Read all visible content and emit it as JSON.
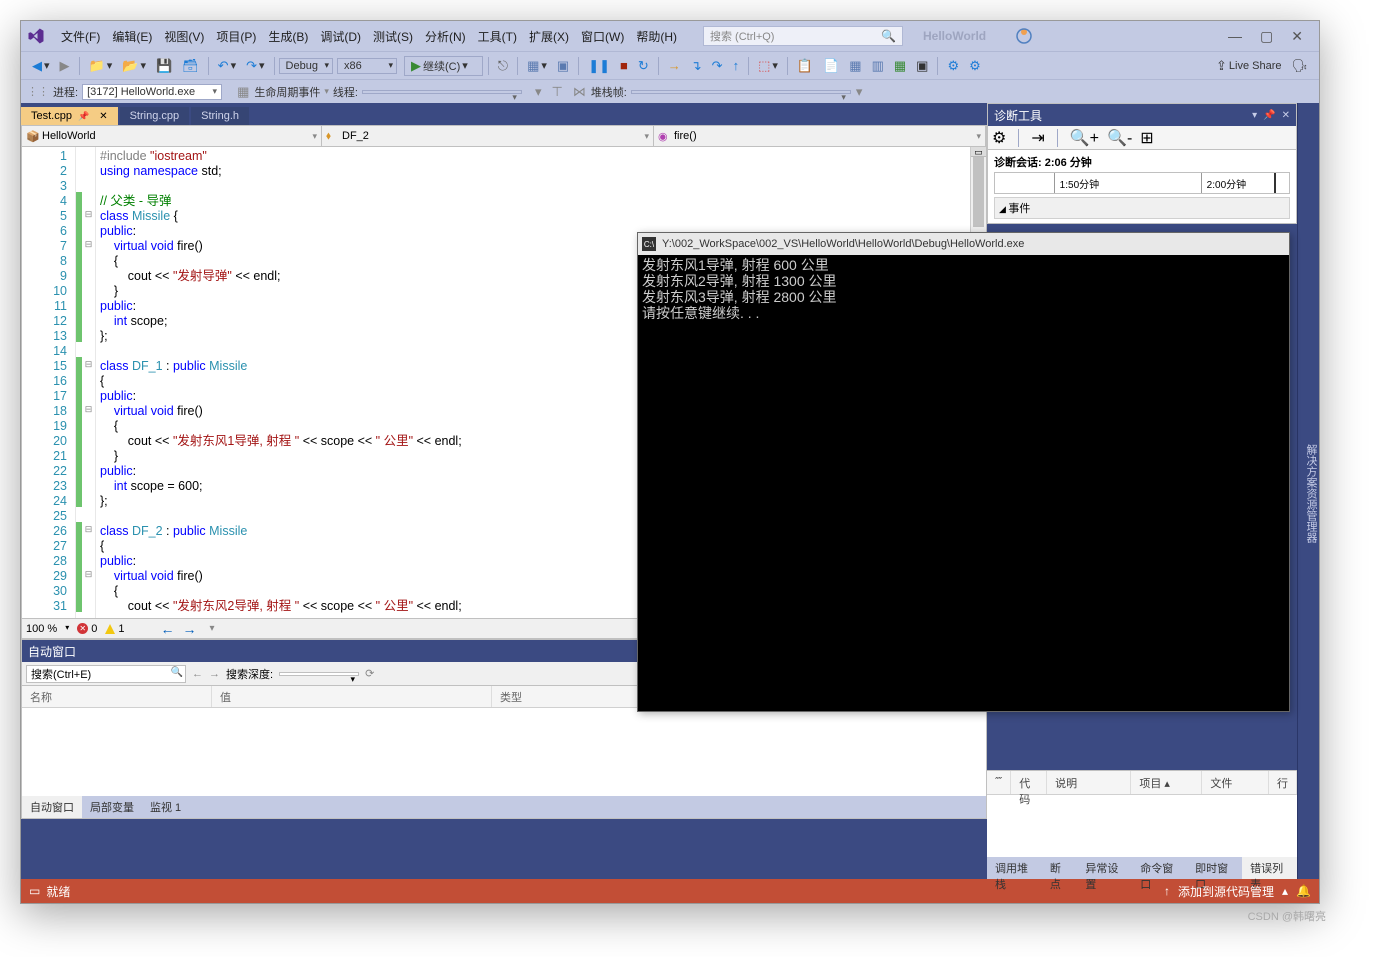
{
  "menu": {
    "file": "文件(F)",
    "edit": "编辑(E)",
    "view": "视图(V)",
    "project": "项目(P)",
    "build": "生成(B)",
    "debug": "调试(D)",
    "test": "测试(S)",
    "analyze": "分析(N)",
    "tools": "工具(T)",
    "extensions": "扩展(X)",
    "window": "窗口(W)",
    "help": "帮助(H)"
  },
  "search": {
    "placeholder": "搜索 (Ctrl+Q)"
  },
  "app_title": "HelloWorld",
  "toolbar": {
    "config": "Debug",
    "platform": "x86",
    "continue": "继续(C)",
    "live_share": "Live Share"
  },
  "toolbar2": {
    "process_label": "进程:",
    "process_value": "[3172] HelloWorld.exe",
    "lifecycle": "生命周期事件",
    "thread": "线程:",
    "stack": "堆栈帧:"
  },
  "tabs": {
    "t1": "Test.cpp",
    "t2": "String.cpp",
    "t3": "String.h"
  },
  "code_header": {
    "scope": "HelloWorld",
    "class": "DF_2",
    "func": "fire()"
  },
  "code": {
    "lines": [
      {
        "n": "1",
        "fold": "",
        "mark": "",
        "html": "<span class='pp'>#include </span><span class='str'>\"iostream\"</span>"
      },
      {
        "n": "2",
        "fold": "",
        "mark": "",
        "html": "<span class='kw'>using</span> <span class='kw'>namespace</span> std;"
      },
      {
        "n": "3",
        "fold": "",
        "mark": "",
        "html": ""
      },
      {
        "n": "4",
        "fold": "",
        "mark": "g",
        "html": "<span class='cmt'>// 父类 - 导弹</span>"
      },
      {
        "n": "5",
        "fold": "⊟",
        "mark": "g",
        "html": "<span class='kw'>class</span> <span class='typ'>Missile</span> {"
      },
      {
        "n": "6",
        "fold": "",
        "mark": "g",
        "html": "<span class='kw'>public</span>:"
      },
      {
        "n": "7",
        "fold": "⊟",
        "mark": "g",
        "html": "    <span class='kw'>virtual</span> <span class='kw'>void</span> fire()"
      },
      {
        "n": "8",
        "fold": "",
        "mark": "g",
        "html": "    {"
      },
      {
        "n": "9",
        "fold": "",
        "mark": "g",
        "html": "        cout &lt;&lt; <span class='str'>\"发射导弹\"</span> &lt;&lt; endl;"
      },
      {
        "n": "10",
        "fold": "",
        "mark": "g",
        "html": "    }"
      },
      {
        "n": "11",
        "fold": "",
        "mark": "g",
        "html": "<span class='kw'>public</span>:"
      },
      {
        "n": "12",
        "fold": "",
        "mark": "g",
        "html": "    <span class='kw'>int</span> scope;"
      },
      {
        "n": "13",
        "fold": "",
        "mark": "g",
        "html": "};"
      },
      {
        "n": "14",
        "fold": "",
        "mark": "",
        "html": ""
      },
      {
        "n": "15",
        "fold": "⊟",
        "mark": "g",
        "html": "<span class='kw'>class</span> <span class='typ'>DF_1</span> : <span class='kw'>public</span> <span class='typ'>Missile</span>"
      },
      {
        "n": "16",
        "fold": "",
        "mark": "g",
        "html": "{"
      },
      {
        "n": "17",
        "fold": "",
        "mark": "g",
        "html": "<span class='kw'>public</span>:"
      },
      {
        "n": "18",
        "fold": "⊟",
        "mark": "g",
        "html": "    <span class='kw'>virtual</span> <span class='kw'>void</span> fire()"
      },
      {
        "n": "19",
        "fold": "",
        "mark": "g",
        "html": "    {"
      },
      {
        "n": "20",
        "fold": "",
        "mark": "g",
        "html": "        cout &lt;&lt; <span class='str'>\"发射东风1导弹, 射程 \"</span> &lt;&lt; scope &lt;&lt; <span class='str'>\" 公里\"</span> &lt;&lt; endl;"
      },
      {
        "n": "21",
        "fold": "",
        "mark": "g",
        "html": "    }"
      },
      {
        "n": "22",
        "fold": "",
        "mark": "g",
        "html": "<span class='kw'>public</span>:"
      },
      {
        "n": "23",
        "fold": "",
        "mark": "g",
        "html": "    <span class='kw'>int</span> scope = 600;"
      },
      {
        "n": "24",
        "fold": "",
        "mark": "g",
        "html": "};"
      },
      {
        "n": "25",
        "fold": "",
        "mark": "",
        "html": ""
      },
      {
        "n": "26",
        "fold": "⊟",
        "mark": "g",
        "html": "<span class='kw'>class</span> <span class='typ'>DF_2</span> : <span class='kw'>public</span> <span class='typ'>Missile</span>"
      },
      {
        "n": "27",
        "fold": "",
        "mark": "g",
        "html": "{"
      },
      {
        "n": "28",
        "fold": "",
        "mark": "g",
        "html": "<span class='kw'>public</span>:"
      },
      {
        "n": "29",
        "fold": "⊟",
        "mark": "g",
        "html": "    <span class='kw'>virtual</span> <span class='kw'>void</span> fire()"
      },
      {
        "n": "30",
        "fold": "",
        "mark": "g",
        "html": "    {"
      },
      {
        "n": "31",
        "fold": "",
        "mark": "g",
        "html": "        cout &lt;&lt; <span class='str'>\"发射东风2导弹, 射程 \"</span> &lt;&lt; scope &lt;&lt; <span class='str'>\" 公里\"</span> &lt;&lt; endl;"
      }
    ],
    "zoom": "100 %",
    "errors": "0",
    "warnings": "1"
  },
  "autos": {
    "title": "自动窗口",
    "search_ph": "搜索(Ctrl+E)",
    "depth_label": "搜索深度:",
    "col_name": "名称",
    "col_value": "值",
    "col_type": "类型",
    "tab1": "自动窗口",
    "tab2": "局部变量",
    "tab3": "监视 1"
  },
  "diag": {
    "title": "诊断工具",
    "session": "诊断会话: 2:06 分钟",
    "tick1": "1:50分钟",
    "tick2": "2:00分钟",
    "events": "事件"
  },
  "error_list": {
    "col_code": "代码",
    "col_desc": "说明",
    "col_proj": "项目",
    "col_file": "文件",
    "col_line": "行",
    "tab1": "调用堆栈",
    "tab2": "断点",
    "tab3": "异常设置",
    "tab4": "命令窗口",
    "tab5": "即时窗口",
    "tab6": "错误列表"
  },
  "console": {
    "title": "Y:\\002_WorkSpace\\002_VS\\HelloWorld\\HelloWorld\\Debug\\HelloWorld.exe",
    "l1": "发射东风1导弹, 射程 600 公里",
    "l2": "发射东风2导弹, 射程 1300 公里",
    "l3": "发射东风3导弹, 射程 2800 公里",
    "l4": "请按任意键继续. . ."
  },
  "status": {
    "ready": "就绪",
    "source_control": "添加到源代码管理"
  },
  "far_right": {
    "label": "解决方案资源管理器"
  },
  "watermark": "CSDN @韩曙亮"
}
